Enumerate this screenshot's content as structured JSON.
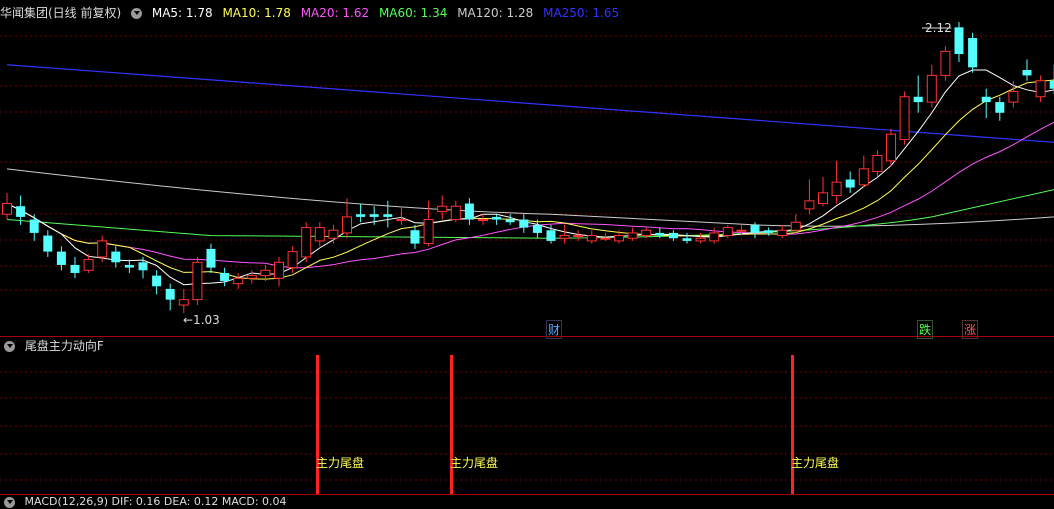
{
  "main_panel": {
    "title": "华闻集团(日线 前复权)",
    "ma_labels": [
      {
        "name": "MA5",
        "value": "1.78",
        "color": "#ffffff",
        "text": "MA5: 1.78"
      },
      {
        "name": "MA10",
        "value": "1.78",
        "color": "#ffff55",
        "text": "MA10: 1.78"
      },
      {
        "name": "MA20",
        "value": "1.62",
        "color": "#ff55ff",
        "text": "MA20: 1.62"
      },
      {
        "name": "MA60",
        "value": "1.34",
        "color": "#55ff55",
        "text": "MA60: 1.34"
      },
      {
        "name": "MA120",
        "value": "1.28",
        "color": "#cccccc",
        "text": "MA120: 1.28"
      },
      {
        "name": "MA250",
        "value": "1.65",
        "color": "#3333ff",
        "text": "MA250: 1.65"
      }
    ],
    "high_marker": "2.12",
    "low_marker": "←1.03",
    "event_markers": [
      {
        "text": "财",
        "color": "#55aaff"
      },
      {
        "text": "跌",
        "color": "#55ff55"
      },
      {
        "text": "涨",
        "color": "#ff5555"
      }
    ]
  },
  "indicator_panel": {
    "title": "尾盘主力动向F",
    "signal_label": "主力尾盘",
    "signal_count": 3
  },
  "macd_panel": {
    "title": "MACD(12,26,9) DIF: 0.16 DEA: 0.12 MACD: 0.04"
  },
  "colors": {
    "up": "#ff3333",
    "down": "#55ffff",
    "grid": "#7a0000",
    "ma5": "#ffffff",
    "ma10": "#ffff55",
    "ma20": "#ff55ff",
    "ma60": "#55ff55",
    "ma120": "#cccccc",
    "ma250": "#3333ff",
    "signal": "#ff2222",
    "signal_text": "#ffff55"
  },
  "chart_data": {
    "type": "candlestick",
    "series": [
      {
        "o": 1.4,
        "c": 1.44,
        "h": 1.48,
        "l": 1.38
      },
      {
        "o": 1.43,
        "c": 1.39,
        "h": 1.47,
        "l": 1.36
      },
      {
        "o": 1.38,
        "c": 1.33,
        "h": 1.4,
        "l": 1.3
      },
      {
        "o": 1.32,
        "c": 1.26,
        "h": 1.34,
        "l": 1.24
      },
      {
        "o": 1.26,
        "c": 1.21,
        "h": 1.28,
        "l": 1.19
      },
      {
        "o": 1.21,
        "c": 1.18,
        "h": 1.24,
        "l": 1.16
      },
      {
        "o": 1.19,
        "c": 1.23,
        "h": 1.25,
        "l": 1.18
      },
      {
        "o": 1.24,
        "c": 1.3,
        "h": 1.32,
        "l": 1.22
      },
      {
        "o": 1.26,
        "c": 1.22,
        "h": 1.28,
        "l": 1.2
      },
      {
        "o": 1.21,
        "c": 1.2,
        "h": 1.23,
        "l": 1.18
      },
      {
        "o": 1.22,
        "c": 1.19,
        "h": 1.24,
        "l": 1.16
      },
      {
        "o": 1.17,
        "c": 1.13,
        "h": 1.19,
        "l": 1.1
      },
      {
        "o": 1.12,
        "c": 1.08,
        "h": 1.14,
        "l": 1.04
      },
      {
        "o": 1.06,
        "c": 1.08,
        "h": 1.12,
        "l": 1.03
      },
      {
        "o": 1.08,
        "c": 1.22,
        "h": 1.24,
        "l": 1.06
      },
      {
        "o": 1.27,
        "c": 1.2,
        "h": 1.29,
        "l": 1.18
      },
      {
        "o": 1.18,
        "c": 1.15,
        "h": 1.2,
        "l": 1.13
      },
      {
        "o": 1.14,
        "c": 1.16,
        "h": 1.18,
        "l": 1.12
      },
      {
        "o": 1.16,
        "c": 1.17,
        "h": 1.19,
        "l": 1.14
      },
      {
        "o": 1.17,
        "c": 1.19,
        "h": 1.21,
        "l": 1.15
      },
      {
        "o": 1.16,
        "c": 1.22,
        "h": 1.24,
        "l": 1.13
      },
      {
        "o": 1.2,
        "c": 1.26,
        "h": 1.28,
        "l": 1.18
      },
      {
        "o": 1.24,
        "c": 1.35,
        "h": 1.37,
        "l": 1.22
      },
      {
        "o": 1.3,
        "c": 1.35,
        "h": 1.37,
        "l": 1.28
      },
      {
        "o": 1.31,
        "c": 1.34,
        "h": 1.36,
        "l": 1.29
      },
      {
        "o": 1.33,
        "c": 1.39,
        "h": 1.46,
        "l": 1.31
      },
      {
        "o": 1.4,
        "c": 1.39,
        "h": 1.44,
        "l": 1.37
      },
      {
        "o": 1.4,
        "c": 1.39,
        "h": 1.43,
        "l": 1.36
      },
      {
        "o": 1.4,
        "c": 1.39,
        "h": 1.45,
        "l": 1.35
      },
      {
        "o": 1.38,
        "c": 1.38,
        "h": 1.43,
        "l": 1.36
      },
      {
        "o": 1.34,
        "c": 1.29,
        "h": 1.36,
        "l": 1.27
      },
      {
        "o": 1.29,
        "c": 1.38,
        "h": 1.45,
        "l": 1.28
      },
      {
        "o": 1.41,
        "c": 1.43,
        "h": 1.47,
        "l": 1.38
      },
      {
        "o": 1.38,
        "c": 1.43,
        "h": 1.45,
        "l": 1.37
      },
      {
        "o": 1.44,
        "c": 1.38,
        "h": 1.46,
        "l": 1.36
      },
      {
        "o": 1.38,
        "c": 1.38,
        "h": 1.4,
        "l": 1.36
      },
      {
        "o": 1.39,
        "c": 1.38,
        "h": 1.4,
        "l": 1.36
      },
      {
        "o": 1.38,
        "c": 1.37,
        "h": 1.4,
        "l": 1.36
      },
      {
        "o": 1.38,
        "c": 1.35,
        "h": 1.4,
        "l": 1.33
      },
      {
        "o": 1.36,
        "c": 1.33,
        "h": 1.38,
        "l": 1.31
      },
      {
        "o": 1.34,
        "c": 1.3,
        "h": 1.36,
        "l": 1.29
      },
      {
        "o": 1.31,
        "c": 1.32,
        "h": 1.36,
        "l": 1.29
      },
      {
        "o": 1.32,
        "c": 1.32,
        "h": 1.34,
        "l": 1.3
      },
      {
        "o": 1.3,
        "c": 1.32,
        "h": 1.34,
        "l": 1.29
      },
      {
        "o": 1.31,
        "c": 1.31,
        "h": 1.33,
        "l": 1.3
      },
      {
        "o": 1.3,
        "c": 1.32,
        "h": 1.34,
        "l": 1.29
      },
      {
        "o": 1.31,
        "c": 1.33,
        "h": 1.35,
        "l": 1.3
      },
      {
        "o": 1.32,
        "c": 1.34,
        "h": 1.35,
        "l": 1.31
      },
      {
        "o": 1.33,
        "c": 1.32,
        "h": 1.35,
        "l": 1.31
      },
      {
        "o": 1.33,
        "c": 1.31,
        "h": 1.34,
        "l": 1.3
      },
      {
        "o": 1.31,
        "c": 1.3,
        "h": 1.33,
        "l": 1.29
      },
      {
        "o": 1.3,
        "c": 1.31,
        "h": 1.33,
        "l": 1.29
      },
      {
        "o": 1.3,
        "c": 1.33,
        "h": 1.35,
        "l": 1.29
      },
      {
        "o": 1.32,
        "c": 1.35,
        "h": 1.36,
        "l": 1.31
      },
      {
        "o": 1.34,
        "c": 1.34,
        "h": 1.36,
        "l": 1.32
      },
      {
        "o": 1.36,
        "c": 1.33,
        "h": 1.37,
        "l": 1.31
      },
      {
        "o": 1.34,
        "c": 1.33,
        "h": 1.35,
        "l": 1.32
      },
      {
        "o": 1.32,
        "c": 1.34,
        "h": 1.36,
        "l": 1.31
      },
      {
        "o": 1.34,
        "c": 1.37,
        "h": 1.4,
        "l": 1.33
      },
      {
        "o": 1.42,
        "c": 1.45,
        "h": 1.53,
        "l": 1.4
      },
      {
        "o": 1.44,
        "c": 1.48,
        "h": 1.54,
        "l": 1.43
      },
      {
        "o": 1.47,
        "c": 1.52,
        "h": 1.6,
        "l": 1.44
      },
      {
        "o": 1.53,
        "c": 1.5,
        "h": 1.56,
        "l": 1.48
      },
      {
        "o": 1.51,
        "c": 1.57,
        "h": 1.62,
        "l": 1.5
      },
      {
        "o": 1.56,
        "c": 1.62,
        "h": 1.64,
        "l": 1.54
      },
      {
        "o": 1.6,
        "c": 1.7,
        "h": 1.72,
        "l": 1.58
      },
      {
        "o": 1.68,
        "c": 1.84,
        "h": 1.86,
        "l": 1.66
      },
      {
        "o": 1.84,
        "c": 1.82,
        "h": 1.92,
        "l": 1.78
      },
      {
        "o": 1.82,
        "c": 1.92,
        "h": 1.96,
        "l": 1.8
      },
      {
        "o": 1.92,
        "c": 2.01,
        "h": 2.03,
        "l": 1.9
      },
      {
        "o": 2.1,
        "c": 2.0,
        "h": 2.12,
        "l": 1.97
      },
      {
        "o": 2.06,
        "c": 1.95,
        "h": 2.08,
        "l": 1.93
      },
      {
        "o": 1.84,
        "c": 1.82,
        "h": 1.87,
        "l": 1.76
      },
      {
        "o": 1.82,
        "c": 1.78,
        "h": 1.84,
        "l": 1.75
      },
      {
        "o": 1.82,
        "c": 1.86,
        "h": 1.9,
        "l": 1.8
      },
      {
        "o": 1.94,
        "c": 1.92,
        "h": 1.98,
        "l": 1.9
      },
      {
        "o": 1.84,
        "c": 1.9,
        "h": 1.92,
        "l": 1.82
      },
      {
        "o": 1.9,
        "c": 1.87,
        "h": 1.96,
        "l": 1.85
      },
      {
        "o": 1.88,
        "c": 1.92,
        "h": 1.97,
        "l": 1.86
      },
      {
        "o": 1.9,
        "c": 1.92,
        "h": 1.95,
        "l": 1.87
      }
    ],
    "ma_lines": {
      "ma250": [
        1.96,
        1.66
      ],
      "ma120": [
        1.57,
        1.47
      ],
      "ma60": [
        1.34,
        1.52
      ]
    },
    "signals_at": [
      22,
      32,
      56
    ]
  }
}
